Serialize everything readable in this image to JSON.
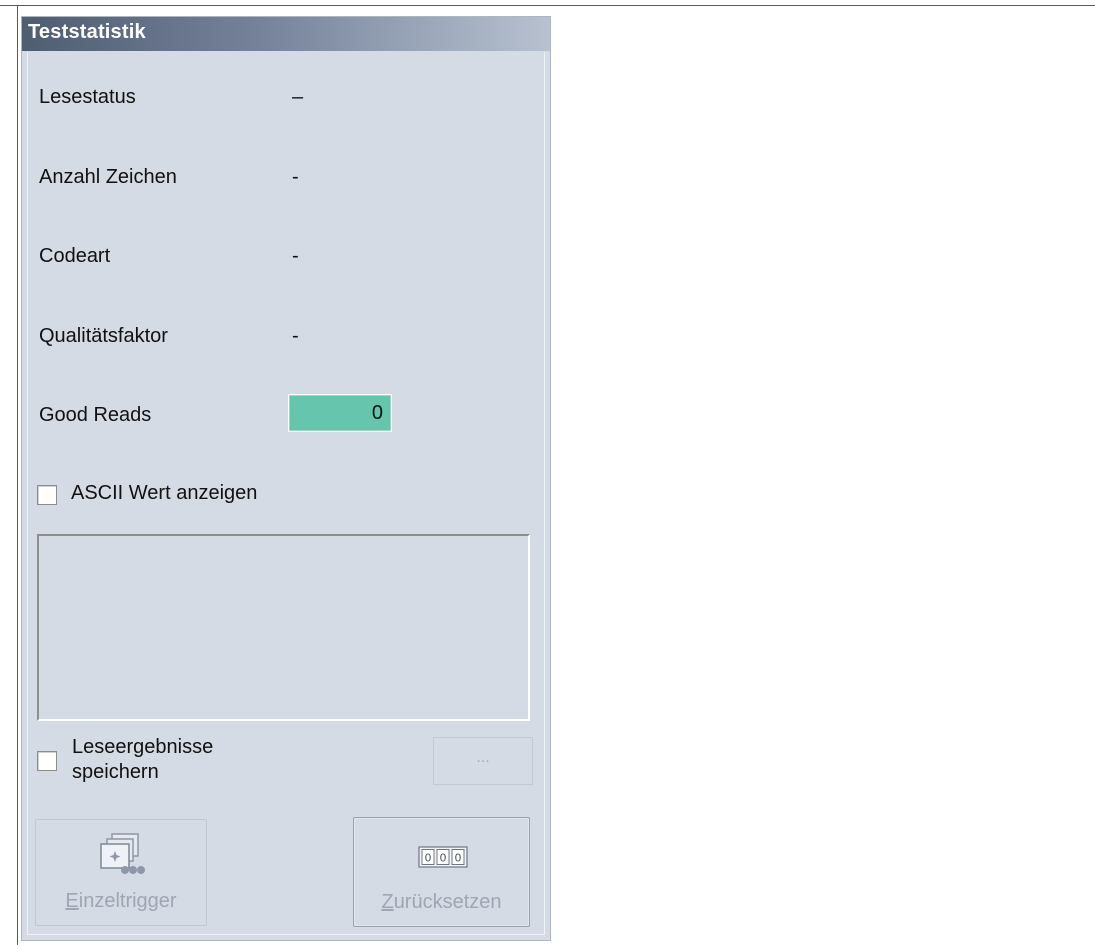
{
  "panel": {
    "title": "Teststatistik"
  },
  "stats": {
    "lesestatus": {
      "label": "Lesestatus",
      "value": "–"
    },
    "anzahl_zeichen": {
      "label": "Anzahl Zeichen",
      "value": "-"
    },
    "codeart": {
      "label": "Codeart",
      "value": "-"
    },
    "qualitaetsfaktor": {
      "label": "Qualitätsfaktor",
      "value": "-"
    },
    "good_reads": {
      "label": "Good Reads",
      "value": "0"
    }
  },
  "ascii": {
    "label": "ASCII Wert anzeigen",
    "checked": false
  },
  "output": {
    "value": ""
  },
  "save": {
    "label_line1": "Leseergebnisse",
    "label_line2": "speichern",
    "checked": false,
    "browse_label": "..."
  },
  "buttons": {
    "einzeltrigger": {
      "label_first": "E",
      "label_rest": "inzeltrigger",
      "icon": "image-stack-icon"
    },
    "zuruecksetzen": {
      "label_first": "Z",
      "label_rest": "urücksetzen",
      "icon": "counter-reset-icon"
    }
  },
  "colors": {
    "panel_bg": "#d5dbe4",
    "good_reads_bg": "#65c6ad",
    "disabled_text": "#9ea6b3"
  }
}
